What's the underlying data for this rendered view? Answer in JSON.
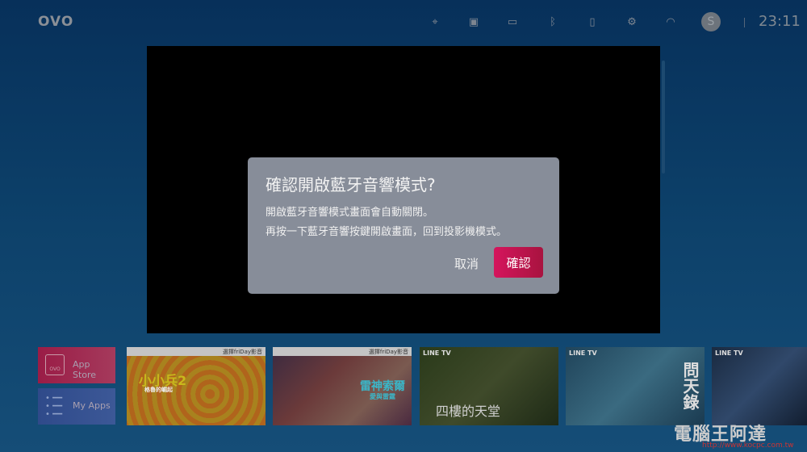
{
  "topbar": {
    "logo": "OVO",
    "time": "23:11",
    "avatar_initial": "S",
    "icons": [
      "focus-icon",
      "screen-mirror-icon",
      "hdmi-icon",
      "bluetooth-icon",
      "battery-icon",
      "settings-icon",
      "wifi-icon"
    ]
  },
  "dialog": {
    "title": "確認開啟藍牙音響模式?",
    "line1": "開啟藍牙音響模式畫面會自動關閉。",
    "line2": "再按一下藍牙音響按鍵開啟畫面，回到投影機模式。",
    "cancel": "取消",
    "confirm": "確認",
    "confirm_color": "#d5155d"
  },
  "tiles": {
    "app_store": "App Store",
    "my_apps": "My Apps",
    "app_store_logo": "OVO"
  },
  "cards": [
    {
      "brand": "選擇friDay影音",
      "title": "小小兵2",
      "subtitle": "格魯的崛起"
    },
    {
      "brand": "選擇friDay影音",
      "title": "雷神索爾",
      "subtitle": "愛與雷霆"
    },
    {
      "brand": "LINE TV",
      "title": "四樓的天堂"
    },
    {
      "brand": "LINE TV",
      "title": "問天錄"
    },
    {
      "brand": "LINE TV"
    }
  ],
  "watermark": {
    "name": "電腦王阿達",
    "url": "http://www.kocpc.com.tw"
  }
}
